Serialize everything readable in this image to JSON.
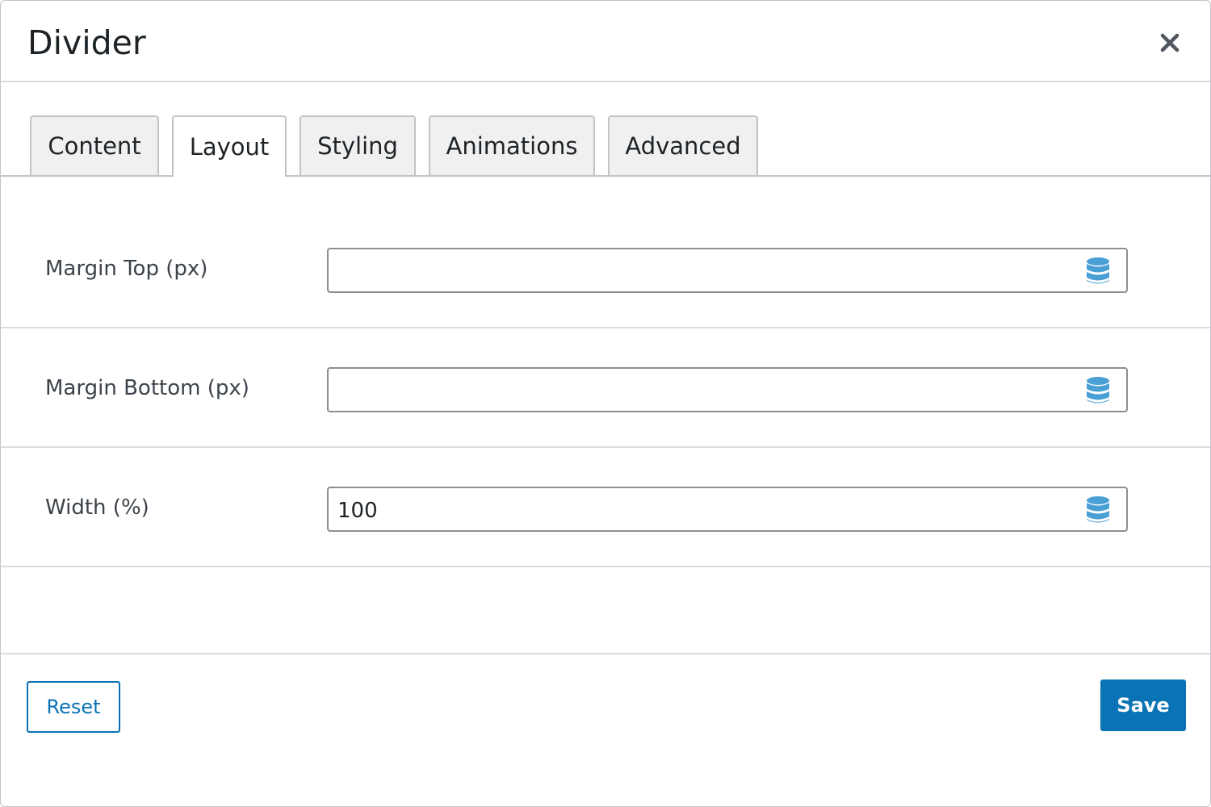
{
  "dialog": {
    "title": "Divider",
    "close_icon": "close-icon"
  },
  "tabs": [
    {
      "label": "Content",
      "active": false
    },
    {
      "label": "Layout",
      "active": true
    },
    {
      "label": "Styling",
      "active": false
    },
    {
      "label": "Animations",
      "active": false
    },
    {
      "label": "Advanced",
      "active": false
    }
  ],
  "fields": [
    {
      "label": "Margin Top (px)",
      "value": "",
      "icon": "database-icon"
    },
    {
      "label": "Margin Bottom (px)",
      "value": "",
      "icon": "database-icon"
    },
    {
      "label": "Width (%)",
      "value": "100",
      "icon": "database-icon"
    }
  ],
  "footer": {
    "reset_label": "Reset",
    "save_label": "Save"
  },
  "colors": {
    "accent": "#0a73b5",
    "icon": "#4a9fd4"
  }
}
